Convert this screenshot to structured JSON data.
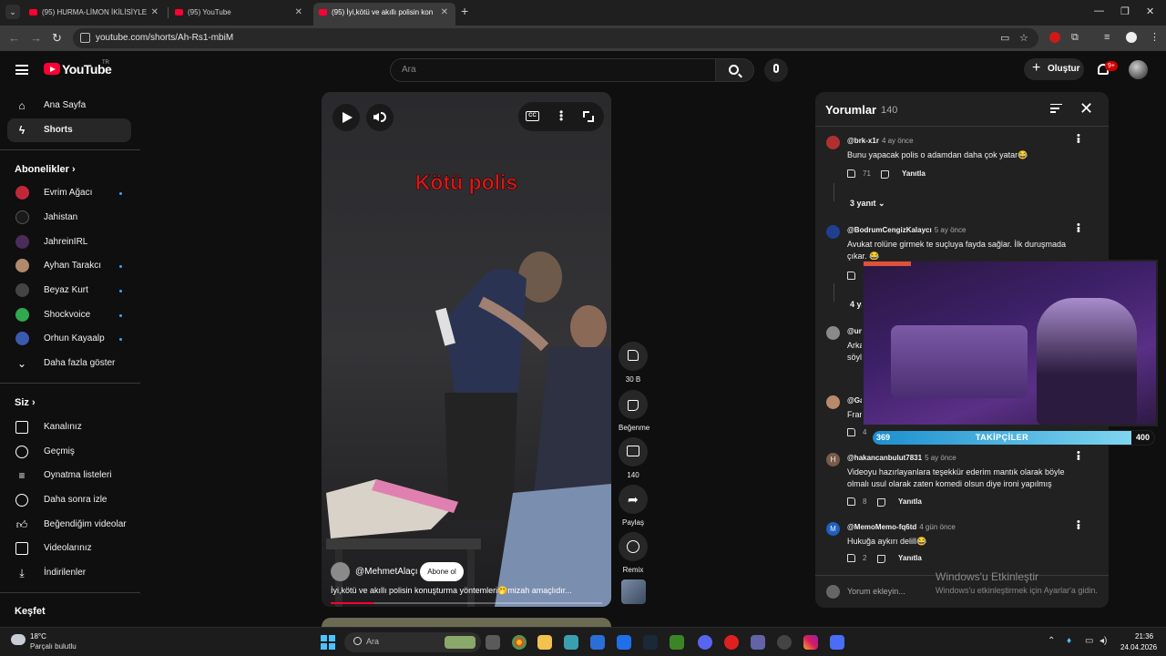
{
  "browser": {
    "tabs": [
      {
        "label": "(95) HURMA-LİMON İKİLİSİYLE"
      },
      {
        "label": "(95) YouTube"
      },
      {
        "label": "(95) İyi,kötü ve akıllı polisin kon"
      }
    ],
    "url": "youtube.com/shorts/Ah-Rs1-mbiM"
  },
  "header": {
    "logo_text": "YouTube",
    "logo_suffix": "TR",
    "search_placeholder": "Ara",
    "create_label": "Oluştur",
    "notifications_badge": "9+"
  },
  "sidebar": {
    "main": [
      {
        "label": "Ana Sayfa",
        "icon": "home-icon"
      },
      {
        "label": "Shorts",
        "icon": "shorts-icon"
      }
    ],
    "subscriptions_title": "Abonelikler",
    "subscriptions": [
      {
        "label": "Evrim Ağacı",
        "color": "#c0283a",
        "new": true
      },
      {
        "label": "Jahistan",
        "color": "#1a1a1a",
        "new": false
      },
      {
        "label": "JahreinIRL",
        "color": "#4a2c5a",
        "new": false
      },
      {
        "label": "Ayhan Tarakcı",
        "color": "#b08a6a",
        "new": true
      },
      {
        "label": "Beyaz Kurt",
        "color": "#444444",
        "new": true
      },
      {
        "label": "Shockvoice",
        "color": "#2fa84f",
        "new": true
      },
      {
        "label": "Orhun Kayaalp",
        "color": "#3a5ab0",
        "new": true
      }
    ],
    "show_more": "Daha fazla göster",
    "you_title": "Siz",
    "you_items": [
      {
        "label": "Kanalınız"
      },
      {
        "label": "Geçmiş"
      },
      {
        "label": "Oynatma listeleri"
      },
      {
        "label": "Daha sonra izle"
      },
      {
        "label": "Beğendiğim videolar"
      },
      {
        "label": "Videolarınız"
      },
      {
        "label": "İndirilenler"
      }
    ],
    "explore_title": "Keşfet"
  },
  "video": {
    "overlay_text": "Kötü polis",
    "channel": "@MehmetAlaçı",
    "subscribe_label": "Abone ol",
    "title": "İyi,kötü ve akıllı polisin konuşturma yöntemleri🤭mizah amaçlıdır...",
    "progress": 0.16
  },
  "actions": {
    "likes": "30 B",
    "dislike_label": "Beğenme",
    "comments": "140",
    "share_label": "Paylaş",
    "remix_label": "Remix"
  },
  "comments": {
    "title": "Yorumlar",
    "count": "140",
    "items": [
      {
        "author": "@brk-x1r",
        "time": "4 ay önce",
        "text": "Bunu yapacak polis o adamdan daha çok yatar😂",
        "likes": "71",
        "reply_label": "Yanıtla",
        "replies": "3 yanıt",
        "avatar_color": "#b03030"
      },
      {
        "author": "@BodrumCengizKalaycı",
        "time": "5 ay önce",
        "text": "Avukat rolüne girmek te suçluya fayda sağlar. İlk duruşmada çıkar. 😂",
        "avatar_color": "#1f3f8f",
        "replies": "4 yanıt"
      },
      {
        "author": "@un",
        "text": "Arka söyl",
        "avatar_color": "#8a8a8a"
      },
      {
        "author": "@Ga",
        "text": "Fran",
        "likes": "4",
        "avatar_color": "#b88a6a"
      },
      {
        "author": "@hakancanbulut7831",
        "time": "5 ay önce",
        "text": "Videoyu hazırlayanlara teşekkür ederim mantık olarak böyle olmalı usul olarak zaten komedi olsun diye ironi yapılmış",
        "likes": "8",
        "reply_label": "Yanıtla",
        "avatar_letter": "H",
        "avatar_color": "#7a5a4a"
      },
      {
        "author": "@MemoMemo-fq6td",
        "time": "4 gün önce",
        "text": "Hukuğa aykırı delill😂",
        "likes": "2",
        "reply_label": "Yanıtla",
        "avatar_letter": "M",
        "avatar_color": "#1e5fbf"
      }
    ],
    "add_placeholder": "Yorum ekleyin..."
  },
  "stream_overlay": {
    "followers_current": "369",
    "followers_label": "TAKİPÇİLER",
    "followers_goal": "400",
    "followers_progress": 0.92
  },
  "watermark": {
    "title": "Windows'u Etkinleştir",
    "subtitle": "Windows'u etkinleştirmek için Ayarlar'a gidin."
  },
  "taskbar": {
    "temperature": "18°C",
    "weather": "Parçalı bulutlu",
    "search_placeholder": "Ara",
    "time": "21:36",
    "date": "24.04.2026"
  }
}
